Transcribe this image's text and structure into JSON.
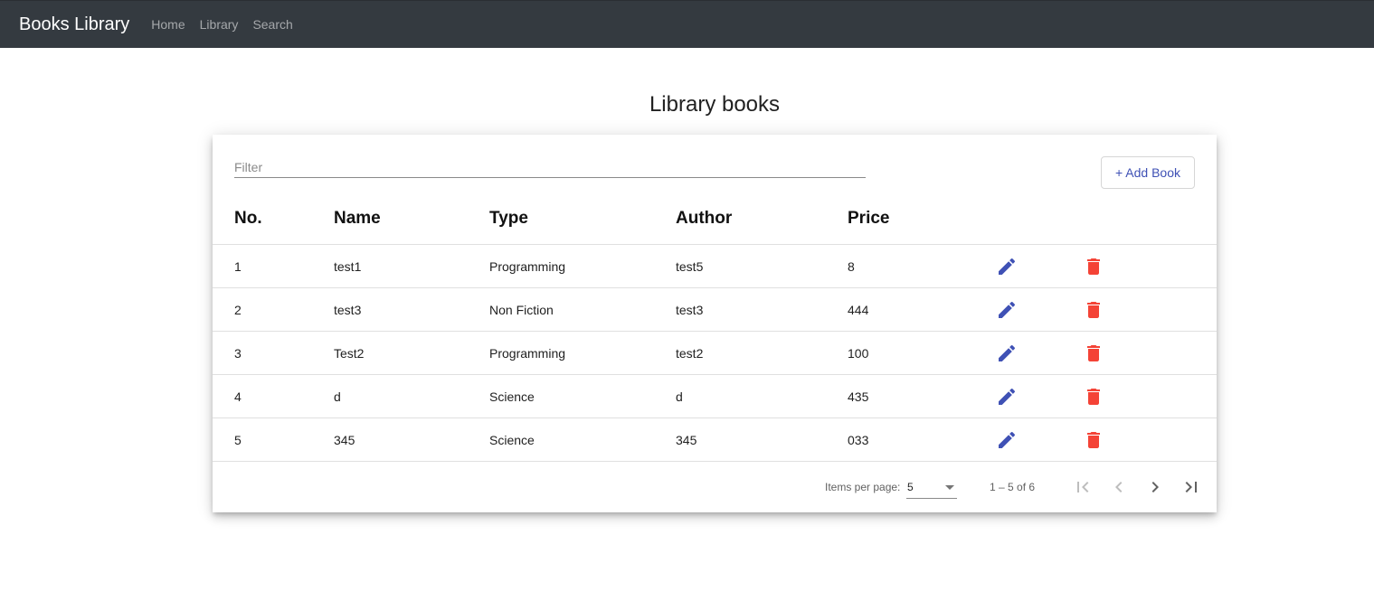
{
  "navbar": {
    "brand": "Books Library",
    "links": [
      "Home",
      "Library",
      "Search"
    ]
  },
  "page": {
    "title": "Library books"
  },
  "filter": {
    "placeholder": "Filter",
    "value": ""
  },
  "add_button": {
    "label": "+ Add Book"
  },
  "table": {
    "headers": [
      "No.",
      "Name",
      "Type",
      "Author",
      "Price"
    ],
    "rows": [
      [
        "1",
        "test1",
        "Programming",
        "test5",
        "8"
      ],
      [
        "2",
        "test3",
        "Non Fiction",
        "test3",
        "444"
      ],
      [
        "3",
        "Test2",
        "Programming",
        "test2",
        "100"
      ],
      [
        "4",
        "d",
        "Science",
        "d",
        "435"
      ],
      [
        "5",
        "345",
        "Science",
        "345",
        "033"
      ]
    ],
    "row_actions": [
      "edit-icon",
      "delete-icon"
    ]
  },
  "paginator": {
    "items_per_page_label": "Items per page:",
    "items_per_page_value": "5",
    "range_label": "1 – 5 of 6",
    "buttons": [
      "first-page-icon",
      "previous-page-icon",
      "next-page-icon",
      "last-page-icon"
    ]
  },
  "colors": {
    "navbar_bg": "#343a40",
    "accent": "#3f51b5",
    "delete": "#f44336",
    "disabled": "#bdbdbd",
    "enabled_icon": "#616161"
  }
}
